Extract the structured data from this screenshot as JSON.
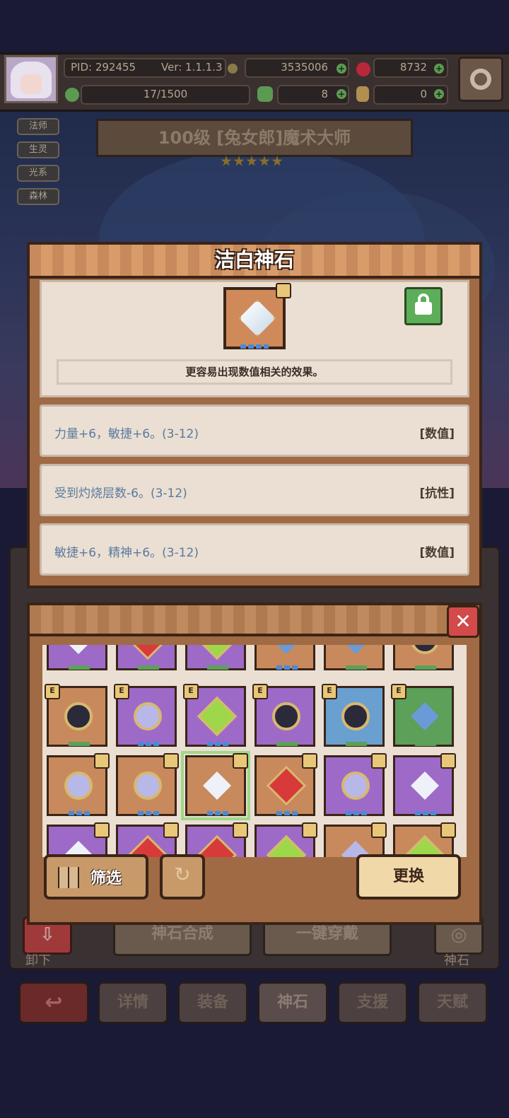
{
  "header": {
    "pid": "PID: 292455",
    "ver": "Ver: 1.1.1.3",
    "gold": "3535006",
    "gems": "8732",
    "stamina": "17/1500",
    "clover": "8",
    "key": "0"
  },
  "tags": [
    "法师",
    "生灵",
    "光系",
    "森林"
  ],
  "character": {
    "title": "100级 [兔女郎]魔术大师",
    "stars": 5
  },
  "dialog": {
    "title": "洁白神石",
    "description": "更容易出现数值相关的效果。",
    "effects": [
      {
        "text": "力量+6，敏捷+6。(3-12)",
        "category": "[数值]"
      },
      {
        "text": "受到灼烧层数-6。(3-12)",
        "category": "[抗性]"
      },
      {
        "text": "敏捷+6，精神+6。(3-12)",
        "category": "[数值]"
      }
    ]
  },
  "inventory": {
    "close": "✕",
    "filter_label": "筛选",
    "replace_label": "更换"
  },
  "background_buttons": {
    "unequip": "卸下",
    "synth": "神石合成",
    "equip_all": "一键穿戴",
    "godstone": "神石"
  },
  "nav": [
    "详情",
    "装备",
    "神石",
    "支援",
    "天赋"
  ],
  "colors": {
    "accent_gold": "#e8c878",
    "panel_brown": "#a06a44",
    "effect_text": "#5a7aa0"
  }
}
